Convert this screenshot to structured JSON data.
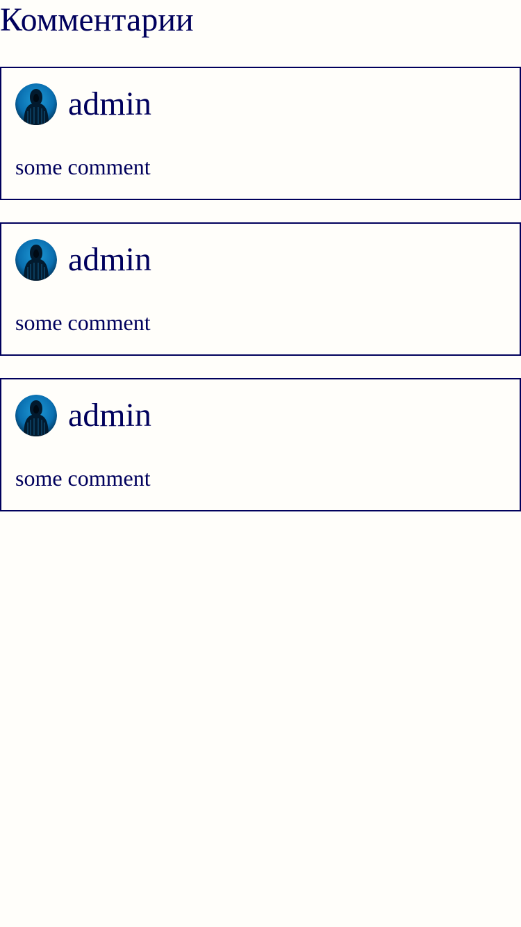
{
  "page": {
    "title": "Комментарии"
  },
  "comments": [
    {
      "author": "admin",
      "text": "some comment",
      "avatar_icon": "hooded-hacker-avatar-icon"
    },
    {
      "author": "admin",
      "text": "some comment",
      "avatar_icon": "hooded-hacker-avatar-icon"
    },
    {
      "author": "admin",
      "text": "some comment",
      "avatar_icon": "hooded-hacker-avatar-icon"
    }
  ],
  "colors": {
    "text": "#00005c",
    "border": "#00005c",
    "background": "#fffefa",
    "avatar_bg": "#0a6fb0"
  }
}
